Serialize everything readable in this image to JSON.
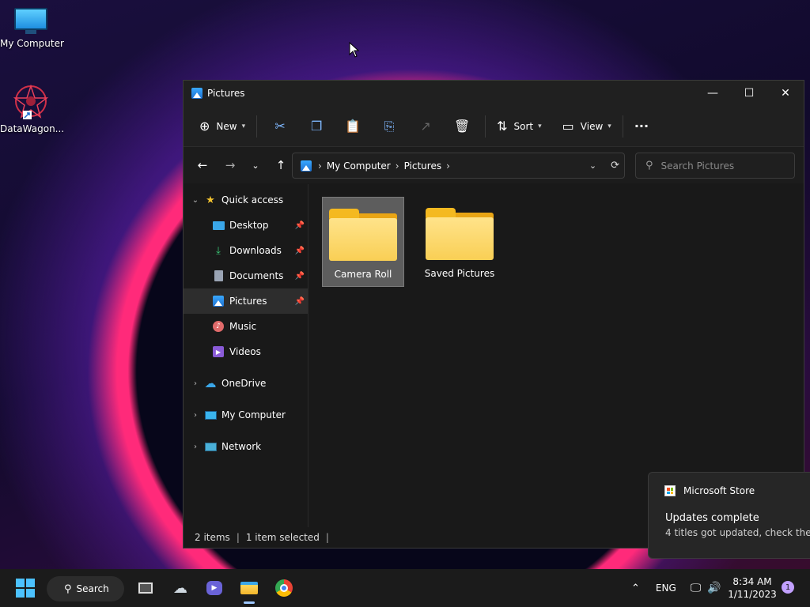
{
  "desktop": {
    "icons": [
      {
        "label": "My Computer",
        "icon": "monitor-icon"
      },
      {
        "label": "DataWagon...",
        "icon": "datawagon-icon"
      }
    ]
  },
  "window": {
    "title": "Pictures",
    "controls": {
      "minimize": "—",
      "maximize": "☐",
      "close": "✕"
    }
  },
  "toolbar": {
    "new_label": "New",
    "sort_label": "Sort",
    "view_label": "View",
    "more_label": "···"
  },
  "address": {
    "crumbs": [
      "My Computer",
      "Pictures"
    ],
    "search_placeholder": "Search Pictures"
  },
  "sidebar": {
    "quick_access": "Quick access",
    "items": [
      {
        "label": "Desktop"
      },
      {
        "label": "Downloads"
      },
      {
        "label": "Documents"
      },
      {
        "label": "Pictures"
      },
      {
        "label": "Music"
      },
      {
        "label": "Videos"
      }
    ],
    "roots": [
      {
        "label": "OneDrive"
      },
      {
        "label": "My Computer"
      },
      {
        "label": "Network"
      }
    ]
  },
  "content": {
    "folders": [
      {
        "label": "Camera Roll",
        "selected": true
      },
      {
        "label": "Saved Pictures",
        "selected": false
      }
    ]
  },
  "status": {
    "items": "2 items",
    "selected": "1 item selected"
  },
  "toast": {
    "app": "Microsoft Store",
    "title": "Updates complete",
    "body": "4 titles got updated, check the"
  },
  "taskbar": {
    "search_label": "Search",
    "lang": "ENG",
    "time": "8:34 AM",
    "date": "1/11/2023",
    "notification_count": "1"
  },
  "colors": {
    "accent": "#4cc2ff",
    "folder": "#f9cf55",
    "window_bg": "#191919"
  }
}
